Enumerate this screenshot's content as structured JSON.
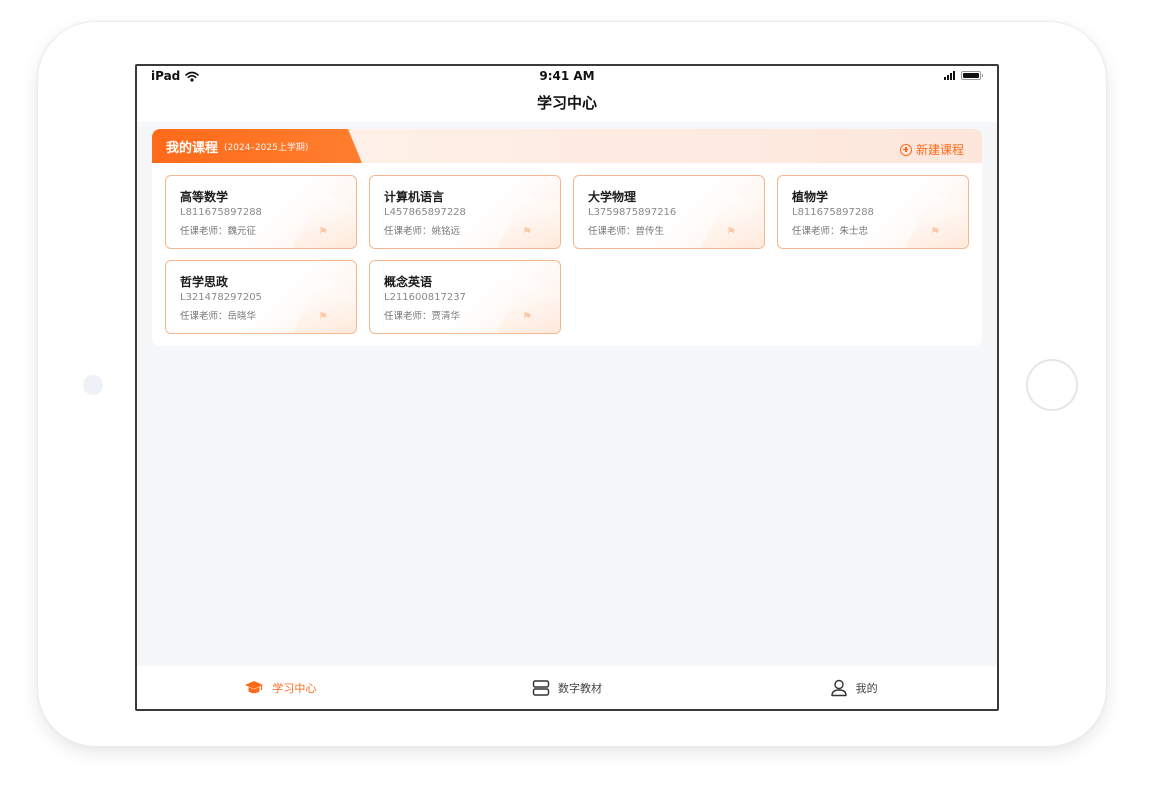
{
  "status_bar": {
    "device": "iPad",
    "time": "9:41 AM"
  },
  "nav": {
    "title": "学习中心"
  },
  "panel": {
    "title": "我的课程",
    "term": "(2024–2025上学期)",
    "new_course_label": "新建课程"
  },
  "courses": [
    {
      "name": "高等数学",
      "code": "L811675897288",
      "teacher": "任课老师：魏元征"
    },
    {
      "name": "计算机语言",
      "code": "L457865897228",
      "teacher": "任课老师：姚铭远"
    },
    {
      "name": "大学物理",
      "code": "L3759875897216",
      "teacher": "任课老师：曾传生"
    },
    {
      "name": "植物学",
      "code": "L811675897288",
      "teacher": "任课老师：朱士忠"
    },
    {
      "name": "哲学思政",
      "code": "L321478297205",
      "teacher": "任课老师：岳晓华"
    },
    {
      "name": "概念英语",
      "code": "L211600817237",
      "teacher": "任课老师：贾清华"
    }
  ],
  "tabs": [
    {
      "label": "学习中心",
      "icon": "graduation-cap-icon",
      "active": true
    },
    {
      "label": "数字教材",
      "icon": "textbook-icon",
      "active": false
    },
    {
      "label": "我的",
      "icon": "user-icon",
      "active": false
    }
  ],
  "colors": {
    "accent": "#ff6a1a",
    "card_border": "#f5b78f",
    "background": "#f6f7f9"
  }
}
